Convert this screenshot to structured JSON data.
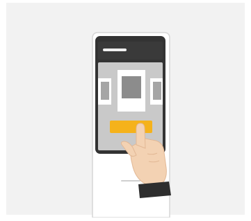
{
  "illustration": {
    "subject": "tap-button-illustration",
    "colors": {
      "outer_background": "#ffffff",
      "panel_background": "#f2f2f2",
      "device_body": "#ffffff",
      "device_outline": "#d6d6d6",
      "screen_frame": "#333333",
      "screen_header": "#3a3a3a",
      "header_line": "#f0f0f0",
      "screen_content": "#c9c9c9",
      "card": "#ffffff",
      "card_image": "#8c8c8c",
      "side_card_image": "#a5a5a5",
      "action_button": "#f5b21b",
      "skin": "#f3d2b3",
      "skin_shadow": "#e2b895",
      "sleeve": "#2e2e2e",
      "base_line": "#cfcfcf"
    }
  }
}
